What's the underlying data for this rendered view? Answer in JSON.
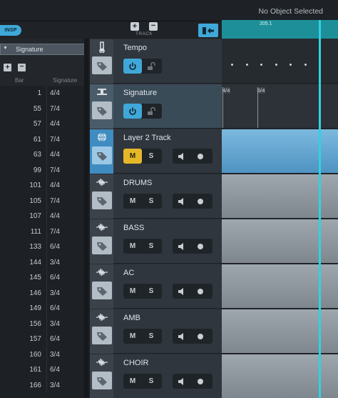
{
  "status": "No Object Selected",
  "inspector_button": "INSP",
  "track_controls": {
    "label": "TRACK",
    "add": "+",
    "remove": "−"
  },
  "ruler": {
    "position_label": "205.1"
  },
  "signature_panel": {
    "title": "Signature",
    "columns": {
      "bar": "Bar",
      "signature": "Signature"
    },
    "rows": [
      {
        "bar": "1",
        "sig": "4/4"
      },
      {
        "bar": "55",
        "sig": "7/4"
      },
      {
        "bar": "57",
        "sig": "4/4"
      },
      {
        "bar": "61",
        "sig": "7/4"
      },
      {
        "bar": "63",
        "sig": "4/4"
      },
      {
        "bar": "99",
        "sig": "7/4"
      },
      {
        "bar": "101",
        "sig": "4/4"
      },
      {
        "bar": "105",
        "sig": "7/4"
      },
      {
        "bar": "107",
        "sig": "4/4"
      },
      {
        "bar": "111",
        "sig": "7/4"
      },
      {
        "bar": "133",
        "sig": "6/4"
      },
      {
        "bar": "144",
        "sig": "3/4"
      },
      {
        "bar": "145",
        "sig": "6/4"
      },
      {
        "bar": "146",
        "sig": "3/4"
      },
      {
        "bar": "149",
        "sig": "6/4"
      },
      {
        "bar": "156",
        "sig": "3/4"
      },
      {
        "bar": "157",
        "sig": "6/4"
      },
      {
        "bar": "160",
        "sig": "3/4"
      },
      {
        "bar": "161",
        "sig": "6/4"
      },
      {
        "bar": "166",
        "sig": "3/4"
      }
    ]
  },
  "tracks": [
    {
      "name": "Tempo",
      "kind": "tempo",
      "icon": "metronome-icon"
    },
    {
      "name": "Signature",
      "kind": "signature",
      "icon": "signature-icon"
    },
    {
      "name": "Layer 2 Track",
      "kind": "audio",
      "icon": "globe-icon",
      "mute": "M",
      "solo": "S"
    },
    {
      "name": "DRUMS",
      "kind": "audio",
      "icon": "waveform-icon",
      "mute": "M",
      "solo": "S"
    },
    {
      "name": "BASS",
      "kind": "audio",
      "icon": "waveform-icon",
      "mute": "M",
      "solo": "S"
    },
    {
      "name": "AC",
      "kind": "audio",
      "icon": "waveform-icon",
      "mute": "M",
      "solo": "S"
    },
    {
      "name": "AMB",
      "kind": "audio",
      "icon": "waveform-icon",
      "mute": "M",
      "solo": "S"
    },
    {
      "name": "CHOIR",
      "kind": "audio",
      "icon": "waveform-icon",
      "mute": "M",
      "solo": "S"
    }
  ],
  "timeline_signature_markers": [
    "4/4",
    "6/4"
  ],
  "colors": {
    "accent": "#3fa8d9",
    "mute_active": "#e6b829",
    "playhead": "#2fd2e4",
    "ruler": "#1d8f99"
  }
}
